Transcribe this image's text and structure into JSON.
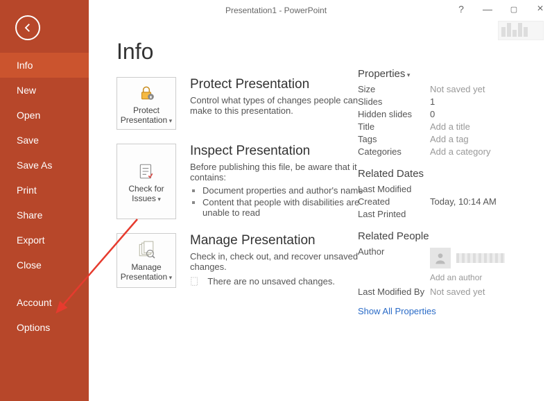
{
  "window": {
    "title": "Presentation1 - PowerPoint",
    "help": "?"
  },
  "sidebar": {
    "items": [
      {
        "label": "Info",
        "active": true
      },
      {
        "label": "New"
      },
      {
        "label": "Open"
      },
      {
        "label": "Save"
      },
      {
        "label": "Save As"
      },
      {
        "label": "Print"
      },
      {
        "label": "Share"
      },
      {
        "label": "Export"
      },
      {
        "label": "Close"
      }
    ],
    "items2": [
      {
        "label": "Account"
      },
      {
        "label": "Options"
      }
    ]
  },
  "page": {
    "heading": "Info"
  },
  "sections": {
    "protect": {
      "btn": "Protect Presentation",
      "title": "Protect Presentation",
      "body": "Control what types of changes people can make to this presentation."
    },
    "inspect": {
      "btn": "Check for Issues",
      "title": "Inspect Presentation",
      "body": "Before publishing this file, be aware that it contains:",
      "items": [
        "Document properties and author's name",
        "Content that people with disabilities are unable to read"
      ]
    },
    "manage": {
      "btn": "Manage Presentation",
      "title": "Manage Presentation",
      "body": "Check in, check out, and recover unsaved changes.",
      "note": "There are no unsaved changes."
    }
  },
  "properties": {
    "header": "Properties",
    "rows": [
      {
        "label": "Size",
        "value": "Not saved yet",
        "ph": true
      },
      {
        "label": "Slides",
        "value": "1"
      },
      {
        "label": "Hidden slides",
        "value": "0"
      },
      {
        "label": "Title",
        "value": "Add a title",
        "ph": true
      },
      {
        "label": "Tags",
        "value": "Add a tag",
        "ph": true
      },
      {
        "label": "Categories",
        "value": "Add a category",
        "ph": true
      }
    ],
    "dates_header": "Related Dates",
    "dates": [
      {
        "label": "Last Modified",
        "value": ""
      },
      {
        "label": "Created",
        "value": "Today, 10:14 AM"
      },
      {
        "label": "Last Printed",
        "value": ""
      }
    ],
    "people_header": "Related People",
    "author_label": "Author",
    "add_author": "Add an author",
    "modified_by_label": "Last Modified By",
    "modified_by_value": "Not saved yet",
    "show_all": "Show All Properties"
  }
}
